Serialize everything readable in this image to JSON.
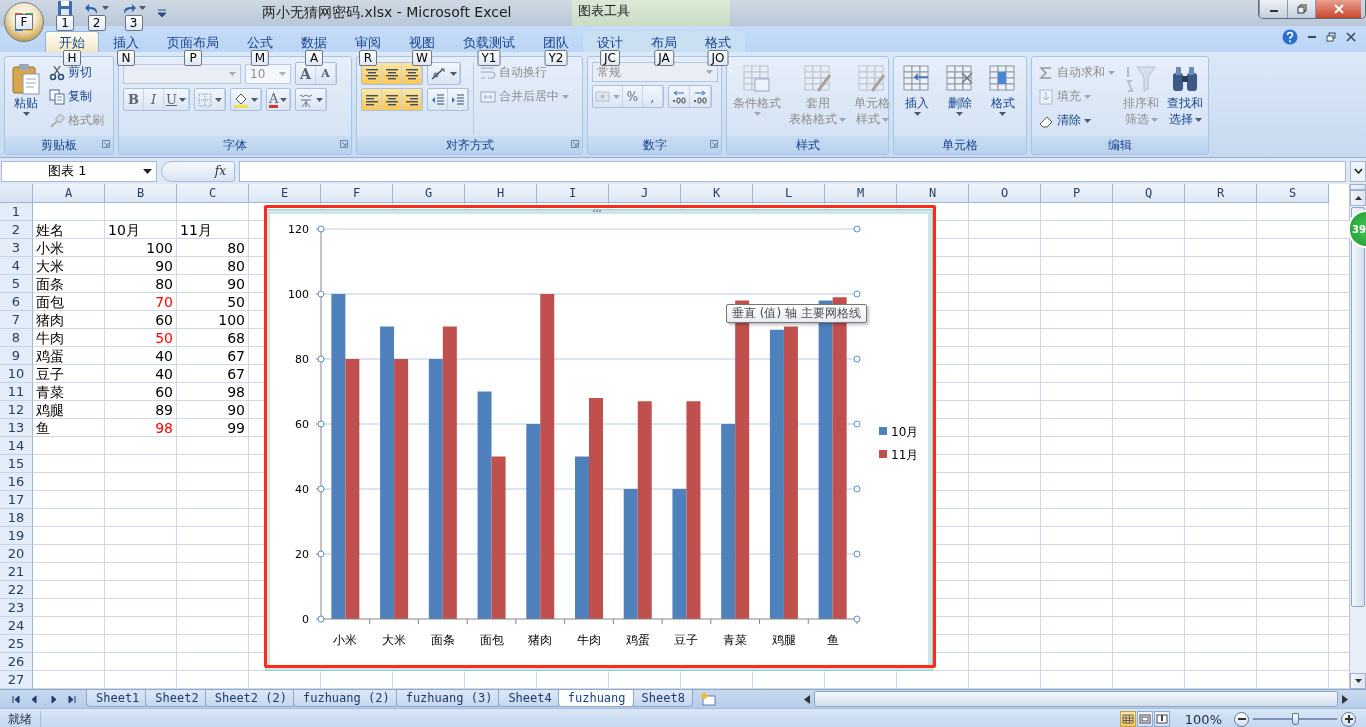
{
  "title_bar": {
    "office_key": "F",
    "quick_access_keys": [
      "1",
      "2",
      "3"
    ],
    "title": "两小无猜网密码.xlsx - Microsoft Excel",
    "context_header": "图表工具"
  },
  "float_badge": {
    "text": "39"
  },
  "ribbon_tabs": [
    {
      "label": "开始",
      "key": "H",
      "selected": true,
      "contextual": false
    },
    {
      "label": "插入",
      "key": "N",
      "selected": false,
      "contextual": false
    },
    {
      "label": "页面布局",
      "key": "P",
      "selected": false,
      "contextual": false
    },
    {
      "label": "公式",
      "key": "M",
      "selected": false,
      "contextual": false
    },
    {
      "label": "数据",
      "key": "A",
      "selected": false,
      "contextual": false
    },
    {
      "label": "审阅",
      "key": "R",
      "selected": false,
      "contextual": false
    },
    {
      "label": "视图",
      "key": "W",
      "selected": false,
      "contextual": false
    },
    {
      "label": "负载测试",
      "key": "Y1",
      "selected": false,
      "contextual": false
    },
    {
      "label": "团队",
      "key": "Y2",
      "selected": false,
      "contextual": false
    },
    {
      "label": "设计",
      "key": "JC",
      "selected": false,
      "contextual": true
    },
    {
      "label": "布局",
      "key": "JA",
      "selected": false,
      "contextual": true
    },
    {
      "label": "格式",
      "key": "JO",
      "selected": false,
      "contextual": true
    }
  ],
  "ribbon_groups": [
    {
      "kind": "clipboard",
      "label": "剪贴板",
      "dialog_launcher": true,
      "paste": "粘贴",
      "actions": [
        {
          "label": "剪切",
          "disabled": false
        },
        {
          "label": "复制",
          "disabled": false
        },
        {
          "label": "格式刷",
          "disabled": true
        }
      ]
    },
    {
      "kind": "font",
      "label": "字体",
      "dialog_launcher": true,
      "font_size": "10",
      "size_buttons": [
        "A",
        "A"
      ],
      "style_buttons": [
        "B",
        "I",
        "U"
      ],
      "color_button": "A"
    },
    {
      "kind": "alignment",
      "label": "对齐方式",
      "dialog_launcher": true,
      "actions": [
        {
          "label": "自动换行",
          "disabled": true
        },
        {
          "label": "合并后居中",
          "disabled": true
        }
      ]
    },
    {
      "kind": "number",
      "label": "数字",
      "dialog_launcher": true,
      "format": "常规",
      "symbols": [
        "%",
        ","
      ]
    },
    {
      "kind": "styles",
      "label": "样式",
      "buttons": [
        {
          "lines": [
            "条件格式"
          ],
          "disabled": true
        },
        {
          "lines": [
            "套用",
            "表格格式"
          ],
          "disabled": true
        },
        {
          "lines": [
            "单元格",
            "样式"
          ],
          "disabled": true
        }
      ]
    },
    {
      "kind": "cells",
      "label": "单元格",
      "buttons": [
        {
          "lines": [
            "插入"
          ],
          "disabled": false
        },
        {
          "lines": [
            "删除"
          ],
          "disabled": false
        },
        {
          "lines": [
            "格式"
          ],
          "disabled": false
        }
      ]
    },
    {
      "kind": "editing",
      "label": "编辑",
      "actions": [
        {
          "label": "自动求和",
          "disabled": true
        },
        {
          "label": "填充",
          "disabled": true
        },
        {
          "label": "清除",
          "disabled": false
        }
      ],
      "buttons": [
        {
          "lines": [
            "排序和",
            "筛选"
          ],
          "disabled": true
        },
        {
          "lines": [
            "查找和",
            "选择"
          ],
          "disabled": false
        }
      ]
    }
  ],
  "formula_bar": {
    "name_box": "图表 1",
    "function_label": "fx"
  },
  "columns": [
    "A",
    "B",
    "C",
    "E",
    "F",
    "G",
    "H",
    "I",
    "J",
    "K",
    "L",
    "M",
    "N",
    "O",
    "P",
    "Q",
    "R",
    "S"
  ],
  "rows": [
    {
      "number": "1"
    },
    {
      "number": "2",
      "cells": [
        {
          "kind": "text",
          "text": "姓名"
        },
        {
          "kind": "text",
          "text": "10月"
        },
        {
          "kind": "text",
          "text": "11月"
        }
      ]
    },
    {
      "number": "3",
      "cells": [
        {
          "kind": "text",
          "text": "小米"
        },
        {
          "kind": "number",
          "text": "100",
          "color": "#000000"
        },
        {
          "kind": "number",
          "text": "80",
          "color": "#000000"
        }
      ]
    },
    {
      "number": "4",
      "cells": [
        {
          "kind": "text",
          "text": "大米"
        },
        {
          "kind": "number",
          "text": "90",
          "color": "#000000"
        },
        {
          "kind": "number",
          "text": "80",
          "color": "#000000"
        }
      ]
    },
    {
      "number": "5",
      "cells": [
        {
          "kind": "text",
          "text": "面条"
        },
        {
          "kind": "number",
          "text": "80",
          "color": "#000000"
        },
        {
          "kind": "number",
          "text": "90",
          "color": "#000000"
        }
      ]
    },
    {
      "number": "6",
      "cells": [
        {
          "kind": "text",
          "text": "面包"
        },
        {
          "kind": "number",
          "text": "70",
          "color": "#ff0000"
        },
        {
          "kind": "number",
          "text": "50",
          "color": "#000000"
        }
      ]
    },
    {
      "number": "7",
      "cells": [
        {
          "kind": "text",
          "text": "猪肉"
        },
        {
          "kind": "number",
          "text": "60",
          "color": "#000000"
        },
        {
          "kind": "number",
          "text": "100",
          "color": "#000000"
        }
      ]
    },
    {
      "number": "8",
      "cells": [
        {
          "kind": "text",
          "text": "牛肉"
        },
        {
          "kind": "number",
          "text": "50",
          "color": "#ff0000"
        },
        {
          "kind": "number",
          "text": "68",
          "color": "#000000"
        }
      ]
    },
    {
      "number": "9",
      "cells": [
        {
          "kind": "text",
          "text": "鸡蛋"
        },
        {
          "kind": "number",
          "text": "40",
          "color": "#000000"
        },
        {
          "kind": "number",
          "text": "67",
          "color": "#000000"
        }
      ]
    },
    {
      "number": "10",
      "cells": [
        {
          "kind": "text",
          "text": "豆子"
        },
        {
          "kind": "number",
          "text": "40",
          "color": "#000000"
        },
        {
          "kind": "number",
          "text": "67",
          "color": "#000000"
        }
      ]
    },
    {
      "number": "11",
      "cells": [
        {
          "kind": "text",
          "text": "青菜"
        },
        {
          "kind": "number",
          "text": "60",
          "color": "#000000"
        },
        {
          "kind": "number",
          "text": "98",
          "color": "#000000"
        }
      ]
    },
    {
      "number": "12",
      "cells": [
        {
          "kind": "text",
          "text": "鸡腿"
        },
        {
          "kind": "number",
          "text": "89",
          "color": "#000000"
        },
        {
          "kind": "number",
          "text": "90",
          "color": "#000000"
        }
      ]
    },
    {
      "number": "13",
      "cells": [
        {
          "kind": "text",
          "text": "鱼"
        },
        {
          "kind": "number",
          "text": "98",
          "color": "#ff0000"
        },
        {
          "kind": "number",
          "text": "99",
          "color": "#000000"
        }
      ]
    },
    {
      "number": "14"
    },
    {
      "number": "15"
    },
    {
      "number": "16"
    },
    {
      "number": "17"
    },
    {
      "number": "18"
    },
    {
      "number": "19"
    },
    {
      "number": "20"
    },
    {
      "number": "21"
    },
    {
      "number": "22"
    },
    {
      "number": "23"
    },
    {
      "number": "24"
    },
    {
      "number": "25"
    },
    {
      "number": "26"
    },
    {
      "number": "27"
    }
  ],
  "chart": {
    "selected": true,
    "annotated": true,
    "gridlines_selected": true,
    "tooltip": "垂直 (值) 轴 主要网格线",
    "chart_data": {
      "type": "bar",
      "categories": [
        "小米",
        "大米",
        "面条",
        "面包",
        "猪肉",
        "牛肉",
        "鸡蛋",
        "豆子",
        "青菜",
        "鸡腿",
        "鱼"
      ],
      "series": [
        {
          "name": "10月",
          "color": "#4f81bd",
          "values": [
            100,
            90,
            80,
            70,
            60,
            50,
            40,
            40,
            60,
            89,
            98
          ]
        },
        {
          "name": "11月",
          "color": "#c0504d",
          "values": [
            80,
            80,
            90,
            50,
            100,
            68,
            67,
            67,
            98,
            90,
            99
          ]
        }
      ],
      "ylim": [
        0,
        120
      ],
      "yticks": [
        0,
        20,
        40,
        60,
        80,
        100,
        120
      ],
      "grid": true,
      "legend": true
    }
  },
  "sheet_tabs": [
    {
      "label": "Sheet1",
      "selected": false
    },
    {
      "label": "Sheet2",
      "selected": false
    },
    {
      "label": "Sheet2 (2)",
      "selected": false
    },
    {
      "label": "fuzhuang (2)",
      "selected": false
    },
    {
      "label": "fuzhuang (3)",
      "selected": false
    },
    {
      "label": "Sheet4",
      "selected": false
    },
    {
      "label": "fuzhuang",
      "selected": true
    },
    {
      "label": "Sheet8",
      "selected": false
    }
  ],
  "status_bar": {
    "status": "就绪",
    "views": [
      {
        "selected": true
      },
      {
        "selected": false
      },
      {
        "selected": false
      }
    ],
    "zoom": "100%",
    "zoom_slider": {
      "level": 0.5
    }
  }
}
